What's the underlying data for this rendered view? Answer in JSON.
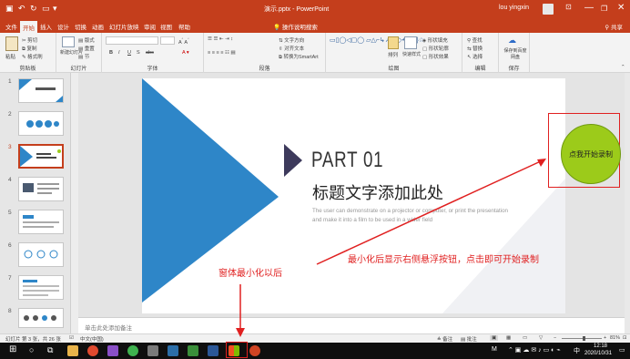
{
  "window": {
    "title": "演示.pptx - PowerPoint",
    "user": "lou yingxin",
    "qat": [
      "↶",
      "↻",
      "▾"
    ],
    "controls": [
      "—",
      "❐",
      "✕"
    ]
  },
  "ribbon_tabs": [
    "文件",
    "开始",
    "插入",
    "设计",
    "切换",
    "动画",
    "幻灯片放映",
    "审阅",
    "视图",
    "帮助",
    "操作说明搜索"
  ],
  "ribbon_share": "共享",
  "ribbon_search": "操作说明搜索",
  "ribbon": {
    "clipboard": {
      "label": "剪贴板",
      "paste": "粘贴",
      "cut": "剪切",
      "copy": "复制",
      "format_painter": "格式刷"
    },
    "slides": {
      "label": "幻灯片",
      "new_slide": "新建幻灯片",
      "layout": "版式",
      "reset": "重置",
      "section": "节"
    },
    "font": {
      "label": "字体",
      "bold": "B",
      "italic": "I",
      "underline": "U",
      "shadow": "S",
      "strike": "abc"
    },
    "paragraph": {
      "label": "段落",
      "text_direction": "文字方向",
      "align_text": "对齐文本",
      "smartart": "转换为SmartArt"
    },
    "drawing": {
      "label": "绘图",
      "arrange": "排列",
      "quick_styles": "快速样式",
      "fill": "形状填充",
      "outline": "形状轮廓",
      "effects": "形状效果"
    },
    "editing": {
      "label": "编辑",
      "find": "查找",
      "replace": "替换",
      "select": "选择"
    },
    "save": {
      "label": "保存",
      "save_to": "保存到百度网盘"
    }
  },
  "thumbnails": [
    {
      "num": "1",
      "selected": false
    },
    {
      "num": "2",
      "selected": false
    },
    {
      "num": "3",
      "selected": true
    },
    {
      "num": "4",
      "selected": false
    },
    {
      "num": "5",
      "selected": false
    },
    {
      "num": "6",
      "selected": false
    },
    {
      "num": "7",
      "selected": false
    },
    {
      "num": "8",
      "selected": false
    }
  ],
  "slide": {
    "part": "PART 01",
    "title": "标题文字添加此处",
    "body_line1": "The user can demonstrate on a projector or computer, or print the presentation",
    "body_line2": "and make it into a film to be used in a wider field"
  },
  "notes_placeholder": "单击此处添加备注",
  "status": {
    "slide_info": "幻灯片 第 3 张，共 26 张",
    "language": "中文(中国)",
    "notes": "备注",
    "comments": "批注",
    "zoom": "81%"
  },
  "taskbar": {
    "time": "12:18",
    "date": "2020/10/31",
    "ime": "M",
    "lang": "中"
  },
  "annotations": {
    "float_button": "点我开始录制",
    "minimize_note": "窗体最小化以后",
    "instruction": "最小化后显示右侧悬浮按钮，点击即可开始录制"
  },
  "colors": {
    "ppt_red": "#c43e1c",
    "slide_blue": "#2e86c8",
    "slide_dark": "#2f2a4a",
    "float_green": "#9ccb1a",
    "annotation_red": "#e02020"
  }
}
